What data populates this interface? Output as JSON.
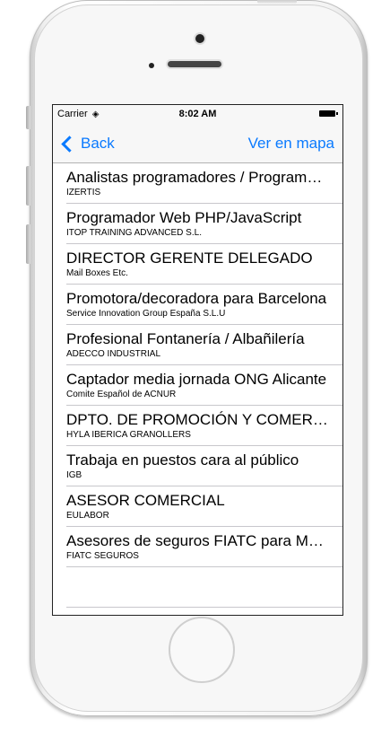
{
  "status_bar": {
    "carrier": "Carrier",
    "wifi_icon": "wifi-icon",
    "time": "8:02 AM",
    "battery_icon": "battery-icon"
  },
  "nav": {
    "back_label": "Back",
    "right_label": "Ver en mapa"
  },
  "jobs": [
    {
      "title": "Analistas programadores / Programadores",
      "company": "IZERTIS"
    },
    {
      "title": "Programador Web PHP/JavaScript",
      "company": "ITOP TRAINING ADVANCED S.L."
    },
    {
      "title": "DIRECTOR GERENTE DELEGADO",
      "company": "Mail Boxes Etc."
    },
    {
      "title": "Promotora/decoradora para Barcelona",
      "company": "Service Innovation Group España S.L.U"
    },
    {
      "title": "Profesional Fontanería / Albañilería",
      "company": "ADECCO INDUSTRIAL"
    },
    {
      "title": "Captador media jornada ONG Alicante",
      "company": "Comite Español de ACNUR"
    },
    {
      "title": "DPTO. DE PROMOCIÓN Y COMERCIAL",
      "company": "HYLA IBERICA GRANOLLERS"
    },
    {
      "title": "Trabaja en puestos cara al público",
      "company": "IGB"
    },
    {
      "title": "ASESOR COMERCIAL",
      "company": "EULABOR"
    },
    {
      "title": "Asesores de seguros FIATC para Madrid",
      "company": "FIATC SEGUROS"
    }
  ]
}
